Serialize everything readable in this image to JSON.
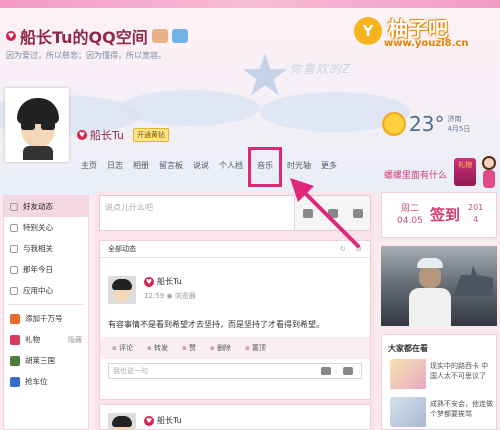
{
  "header": {
    "space_title": "船长Tu的QQ空间",
    "motto": "因为爱过，所以慈悲；因为懂得，所以宽容。",
    "watermark": "你喜欢的Z"
  },
  "logo": {
    "circle_letter": "Y",
    "name": "柚子吧",
    "url": "www.youzi8.cn"
  },
  "profile": {
    "nickname": "船长Tu",
    "badge": "开通黄钻"
  },
  "weather": {
    "temperature": "23",
    "unit": "°",
    "city": "济南",
    "date": "4月5日"
  },
  "nav": {
    "items": [
      "主页",
      "日志",
      "相册",
      "留言板",
      "说说",
      "个人档",
      "音乐",
      "时光轴",
      "更多"
    ],
    "highlighted": "音乐"
  },
  "promo": {
    "text": "螺螺里面有什么",
    "gift_label": "礼物"
  },
  "sidebar": {
    "items": [
      {
        "label": "好友动态",
        "icon": "bell-icon"
      },
      {
        "label": "特别关心",
        "icon": "heart-icon"
      },
      {
        "label": "与我相关",
        "icon": "at-icon"
      },
      {
        "label": "那年今日",
        "icon": "calendar-icon"
      },
      {
        "label": "应用中心",
        "icon": "apps-icon"
      }
    ],
    "apps": [
      {
        "label": "添加千万号",
        "extra": "",
        "color": "#e66a2c"
      },
      {
        "label": "礼物",
        "extra": "隐藏",
        "color": "#d63a5b"
      },
      {
        "label": "胡莱三国",
        "extra": "",
        "color": "#4a7d3a"
      },
      {
        "label": "抢车位",
        "extra": "",
        "color": "#3a6bc6"
      }
    ]
  },
  "compose": {
    "placeholder": "说点儿什么吧"
  },
  "feed": {
    "tab": "全部动态",
    "post": {
      "author": "船长Tu",
      "time": "12:59",
      "source": "浏览器",
      "text": "有容事情不是看到希望才去坚持，而是坚持了才看得到希望。",
      "actions": [
        "评论",
        "转发",
        "赞",
        "删除",
        "置顶"
      ],
      "comment_placeholder": "我也说一句"
    },
    "post2_author": "船长Tu"
  },
  "sign": {
    "weekday": "周二",
    "date_short": "04.05",
    "button": "签到",
    "year": "201",
    "day": "4"
  },
  "watch": {
    "title": "大家都在看",
    "items": [
      {
        "text": "现实中的路西卡 中国人太不可思议了"
      },
      {
        "text": "成熟不安会，他连做个梦都要挨骂"
      }
    ]
  },
  "colors": {
    "accent": "#e0287a",
    "title": "#8e2b4a"
  }
}
